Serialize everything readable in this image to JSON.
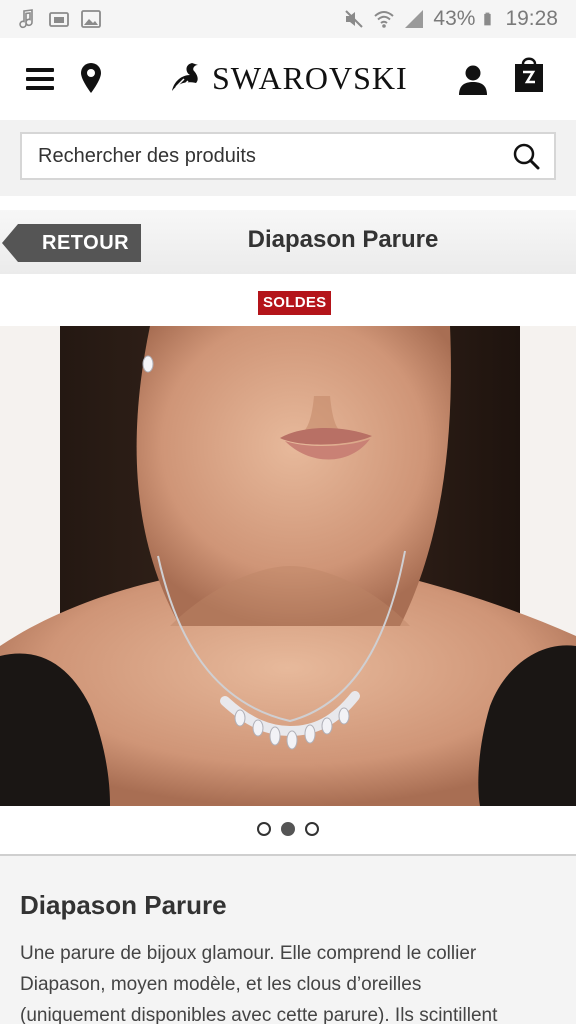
{
  "status_bar": {
    "battery_percent": "43%",
    "time": "19:28",
    "icons": [
      "music-note-icon",
      "cast-icon",
      "image-icon",
      "mute-icon",
      "wifi-icon",
      "signal-icon",
      "battery-icon"
    ]
  },
  "header": {
    "brand": "SWAROVSKI",
    "icons": [
      "menu-icon",
      "location-pin-icon",
      "user-icon",
      "shopping-bag-icon"
    ]
  },
  "search": {
    "placeholder": "Rechercher des produits"
  },
  "title_bar": {
    "back_label": "RETOUR",
    "title": "Diapason Parure"
  },
  "product": {
    "badge": "SOLDES",
    "carousel": {
      "total": 3,
      "active_index": 1
    },
    "name": "Diapason Parure",
    "description": "Une parure de bijoux glamour. Elle comprend le collier\nDiapason, moyen modèle, et les clous d’oreilles\n(uniquement disponibles avec cette parure). Ils scintillent"
  },
  "colors": {
    "sale_red": "#b4141a",
    "back_button": "#555555"
  }
}
